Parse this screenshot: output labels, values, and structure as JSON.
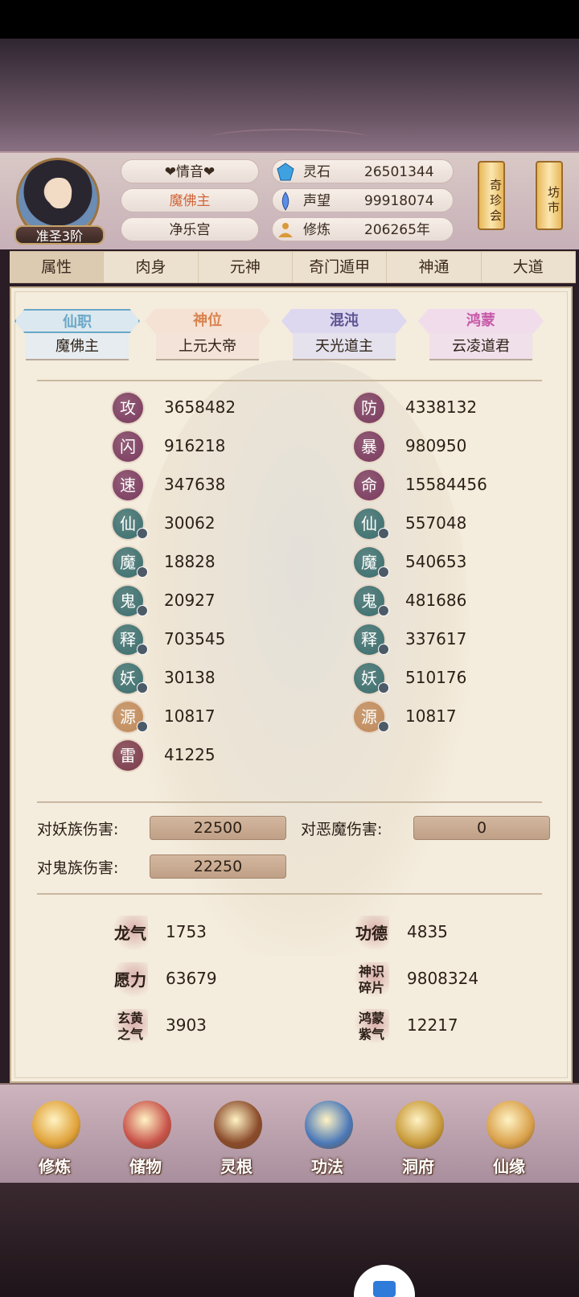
{
  "header": {
    "player_name": "❤情音❤",
    "title": "魔佛主",
    "sect": "净乐宫",
    "rank": "准圣3阶",
    "resources": [
      {
        "icon": "spirit-stone-icon",
        "label": "灵石",
        "value": "26501344"
      },
      {
        "icon": "reputation-icon",
        "label": "声望",
        "value": "99918074"
      },
      {
        "icon": "cultivation-icon",
        "label": "修炼",
        "value": "206265年"
      }
    ],
    "side_buttons": [
      {
        "label": "奇珍会"
      },
      {
        "label": "坊市"
      }
    ]
  },
  "tabs": [
    "属性",
    "肉身",
    "元神",
    "奇门遁甲",
    "神通",
    "大道"
  ],
  "titles": [
    {
      "head": "仙职",
      "body": "魔佛主",
      "color": "#6aa7c7"
    },
    {
      "head": "神位",
      "body": "上元大帝",
      "color": "#d9834f"
    },
    {
      "head": "混沌",
      "body": "天光道主",
      "color": "#6b5f9e"
    },
    {
      "head": "鸿蒙",
      "body": "云凌道君",
      "color": "#c75aa8"
    }
  ],
  "stats_left": [
    {
      "char": "攻",
      "value": "3658482",
      "color": "#7a3a5e"
    },
    {
      "char": "闪",
      "value": "916218",
      "color": "#7a3a5e"
    },
    {
      "char": "速",
      "value": "347638",
      "color": "#7a3a5e"
    },
    {
      "char": "仙",
      "value": "30062",
      "color": "#3a6e6e"
    },
    {
      "char": "魔",
      "value": "18828",
      "color": "#3a6e6e"
    },
    {
      "char": "鬼",
      "value": "20927",
      "color": "#3a6e6e"
    },
    {
      "char": "释",
      "value": "703545",
      "color": "#3a6e6e"
    },
    {
      "char": "妖",
      "value": "30138",
      "color": "#3a6e6e"
    },
    {
      "char": "源",
      "value": "10817",
      "color": "#c08a5a"
    },
    {
      "char": "雷",
      "value": "41225",
      "color": "#7a3a4a"
    }
  ],
  "stats_right": [
    {
      "char": "防",
      "value": "4338132",
      "color": "#7a3a5e"
    },
    {
      "char": "暴",
      "value": "980950",
      "color": "#7a3a5e"
    },
    {
      "char": "命",
      "value": "15584456",
      "color": "#7a3a5e"
    },
    {
      "char": "仙",
      "value": "557048",
      "color": "#3a6e6e"
    },
    {
      "char": "魔",
      "value": "540653",
      "color": "#3a6e6e"
    },
    {
      "char": "鬼",
      "value": "481686",
      "color": "#3a6e6e"
    },
    {
      "char": "释",
      "value": "337617",
      "color": "#3a6e6e"
    },
    {
      "char": "妖",
      "value": "510176",
      "color": "#3a6e6e"
    },
    {
      "char": "源",
      "value": "10817",
      "color": "#c08a5a"
    }
  ],
  "damage": [
    {
      "label": "对妖族伤害:",
      "value": "22500"
    },
    {
      "label": "对恶魔伤害:",
      "value": "0"
    },
    {
      "label": "对鬼族伤害:",
      "value": "22250"
    }
  ],
  "extras": [
    {
      "label": "龙气",
      "value": "1753"
    },
    {
      "label": "功德",
      "value": "4835"
    },
    {
      "label": "愿力",
      "value": "63679"
    },
    {
      "label": "神识碎片",
      "value": "9808324"
    },
    {
      "label": "玄黄之气",
      "value": "3903"
    },
    {
      "label": "鸿蒙紫气",
      "value": "12217"
    }
  ],
  "nav": [
    {
      "label": "修炼",
      "icon": "meditation-icon"
    },
    {
      "label": "储物",
      "icon": "bag-icon"
    },
    {
      "label": "灵根",
      "icon": "root-icon"
    },
    {
      "label": "功法",
      "icon": "book-icon"
    },
    {
      "label": "洞府",
      "icon": "palace-icon"
    },
    {
      "label": "仙缘",
      "icon": "gourd-icon"
    }
  ]
}
